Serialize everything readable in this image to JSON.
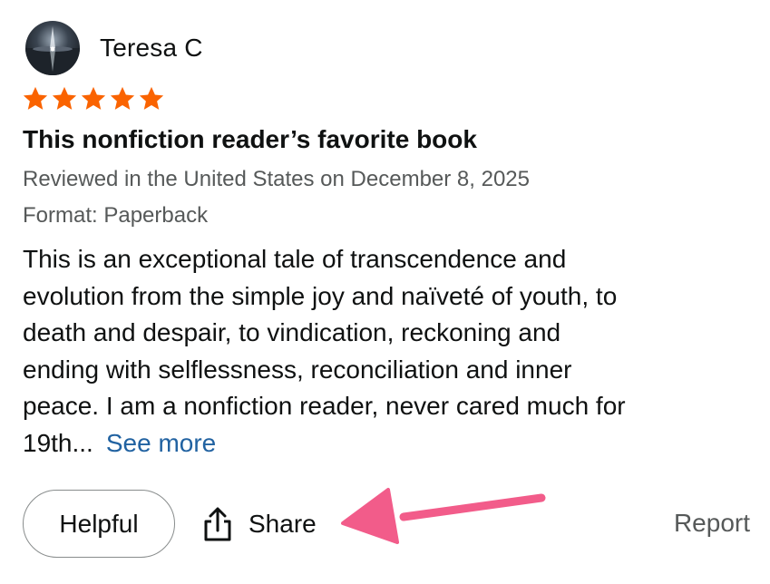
{
  "review": {
    "author": {
      "name": "Teresa C",
      "avatar_icon": "avatar-photo"
    },
    "rating": {
      "stars": 5,
      "max": 5,
      "color": "#fa6300"
    },
    "title": "This nonfiction reader’s favorite book",
    "reviewed_line": "Reviewed in the United States on December 8, 2025",
    "format_line": "Format: Paperback",
    "body_lines": [
      "This is an exceptional tale of transcendence and",
      "evolution from the simple joy and naïveté of youth, to",
      "death and despair, to vindication, reckoning and",
      "ending with selflessness, reconciliation and inner",
      "peace. I am a nonfiction reader, never cared much for",
      "19th..."
    ],
    "see_more_label": "See more",
    "actions": {
      "helpful_label": "Helpful",
      "share_label": "Share",
      "share_icon": "share-icon",
      "report_label": "Report"
    }
  },
  "annotation": {
    "arrow_color": "#f25c8a",
    "target": "share-button"
  },
  "colors": {
    "text": "#0f1111",
    "secondary_text": "#565959",
    "link": "#2162a1",
    "button_border": "#888c8c"
  }
}
